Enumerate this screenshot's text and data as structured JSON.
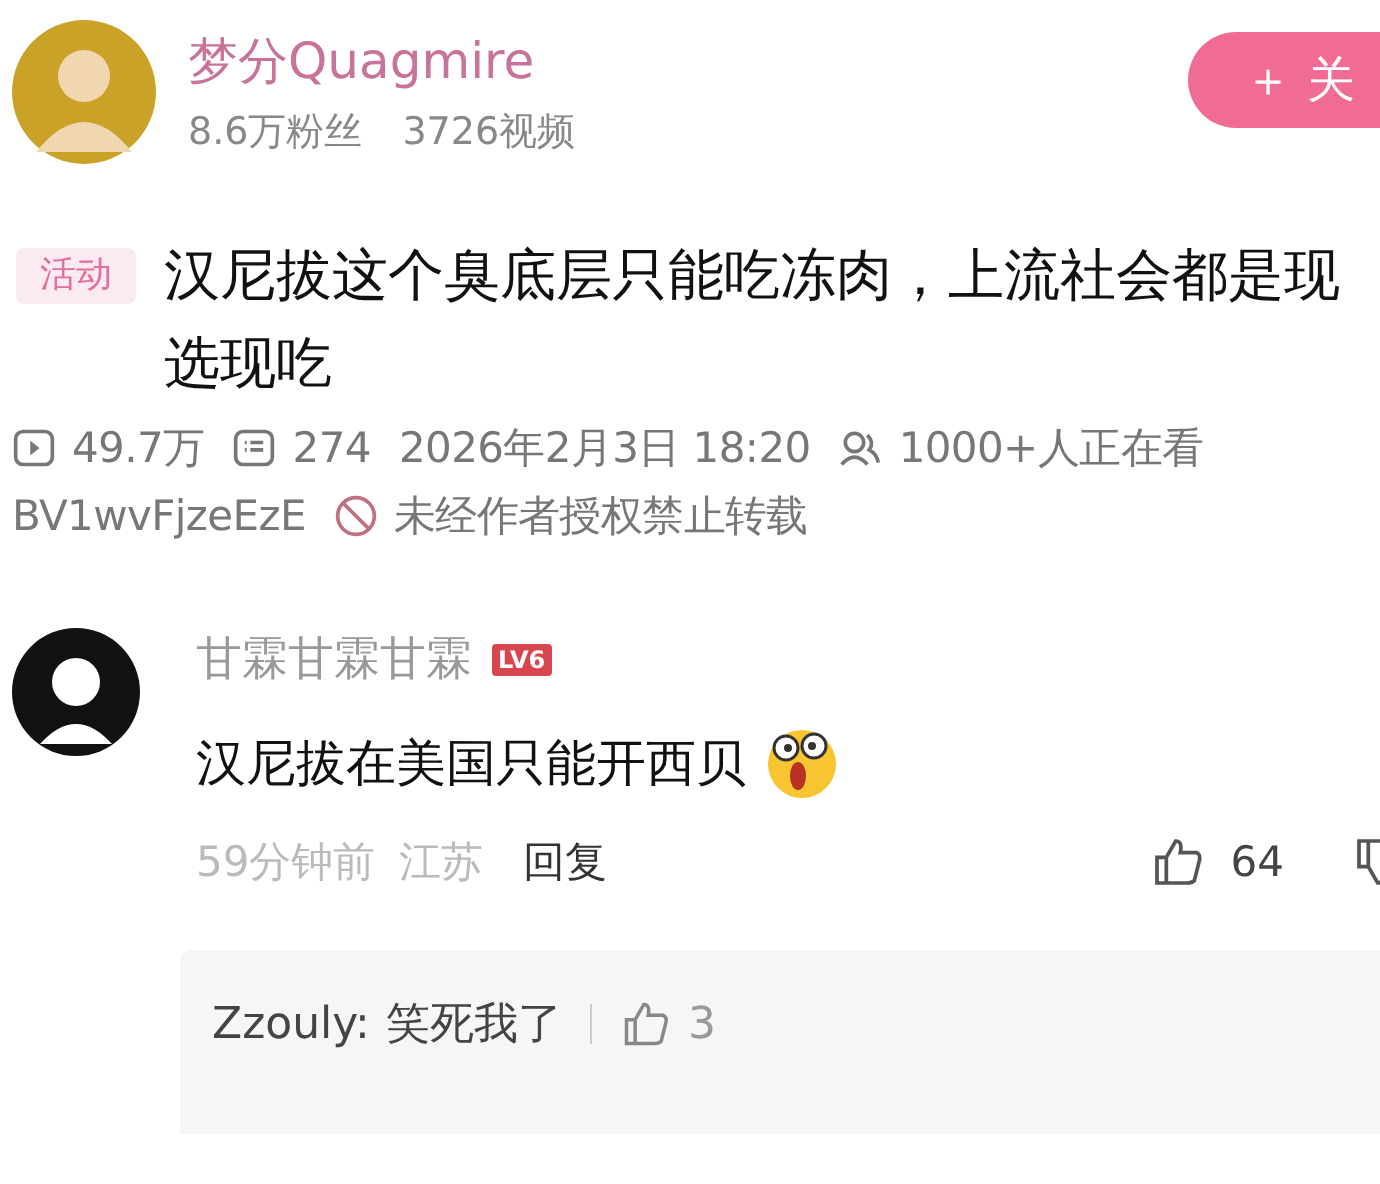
{
  "uploader": {
    "name": "梦分Quagmire",
    "followers": "8.6万粉丝",
    "videos": "3726视频",
    "follow_button": "＋ 关"
  },
  "video": {
    "tag": "活动",
    "title": "汉尼拔这个臭底层只能吃冻肉，上流社会都是现选现吃",
    "views": "49.7万",
    "danmaku": "274",
    "date": "2026年2月3日 18:20",
    "watching": "1000+人正在看",
    "bvid": "BV1wvFjzeEzE",
    "notice": "未经作者授权禁止转载"
  },
  "comments": [
    {
      "user": "甘霖甘霖甘霖",
      "level": "LV6",
      "text": "汉尼拔在美国只能开西贝",
      "time": "59分钟前",
      "location": "江苏",
      "reply": "回复",
      "likes": "64",
      "replies": [
        {
          "user": "Zzouly:",
          "text": "笑死我了",
          "likes": "3"
        }
      ]
    }
  ]
}
